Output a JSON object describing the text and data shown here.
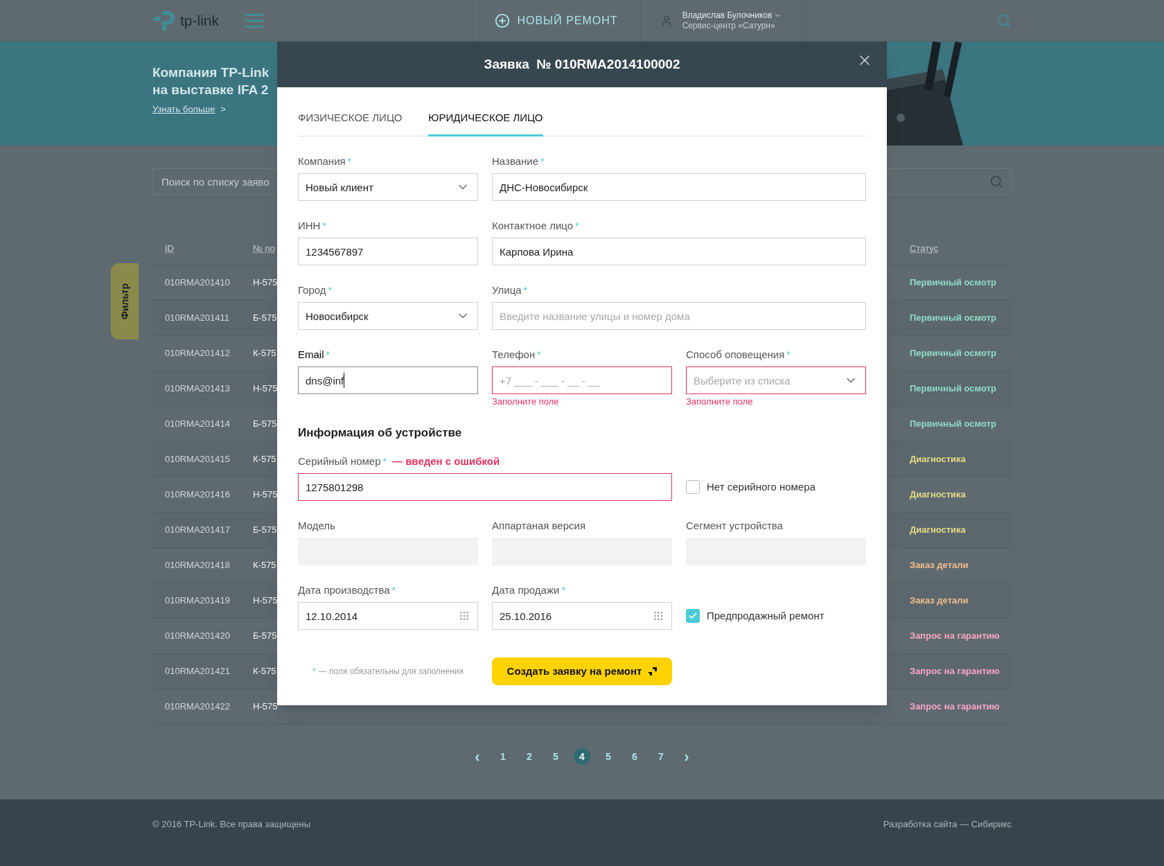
{
  "header": {
    "logo": "tp-link",
    "new_repair": "НОВЫЙ РЕМОНТ",
    "user_name": "Владислав Булочников",
    "user_org": "Сервис-центр «Сатурн»"
  },
  "banner": {
    "title_lines": [
      "Компания TP-Link",
      "на выставке IFA 2"
    ],
    "link": "Узнать больше",
    "link_arrow": ">"
  },
  "search": {
    "placeholder": "Поиск по списку заяво"
  },
  "filter_tab": {
    "label": "Фильтр"
  },
  "table": {
    "columns": [
      "ID",
      "№ по",
      "Статус"
    ],
    "rows": [
      {
        "id": "010RMA201410",
        "number": "Н-575",
        "status": "Первичный осмотр",
        "color": "#8fdcc4"
      },
      {
        "id": "010RMA201411",
        "number": "Б-575",
        "status": "Первичный осмотр",
        "color": "#8fdcc4"
      },
      {
        "id": "010RMA201412",
        "number": "К-575",
        "status": "Первичный осмотр",
        "color": "#8fdcc4"
      },
      {
        "id": "010RMA201413",
        "number": "Н-575",
        "status": "Первичный осмотр",
        "color": "#8fdcc4"
      },
      {
        "id": "010RMA201414",
        "number": "Б-575",
        "status": "Первичный осмотр",
        "color": "#8fdcc4"
      },
      {
        "id": "010RMA201415",
        "number": "К-575",
        "status": "Диагностика",
        "color": "#e6da86"
      },
      {
        "id": "010RMA201416",
        "number": "Н-575",
        "status": "Диагностика",
        "color": "#e6da86"
      },
      {
        "id": "010RMA201417",
        "number": "Б-575",
        "status": "Диагностика",
        "color": "#e6da86"
      },
      {
        "id": "010RMA201418",
        "number": "К-575",
        "status": "Заказ детали",
        "color": "#f2bb8c"
      },
      {
        "id": "010RMA201419",
        "number": "Н-575",
        "status": "Заказ детали",
        "color": "#f2bb8c"
      },
      {
        "id": "010RMA201420",
        "number": "Б-575",
        "status": "Запрос на гарантию",
        "color": "#f7a6c2"
      },
      {
        "id": "010RMA201421",
        "number": "К-575",
        "status": "Запрос на гарантию",
        "color": "#f7a6c2"
      },
      {
        "id": "010RMA201422",
        "number": "Н-575",
        "status": "Запрос на гарантию",
        "color": "#f7a6c2"
      }
    ]
  },
  "pagination": {
    "prev": "‹",
    "next": "›",
    "pages": [
      {
        "label": "1",
        "selected": false
      },
      {
        "label": "2",
        "selected": false
      },
      {
        "label": "5",
        "selected": false
      },
      {
        "label": "4",
        "selected": true
      },
      {
        "label": "5",
        "selected": false
      },
      {
        "label": "6",
        "selected": false
      },
      {
        "label": "7",
        "selected": false
      }
    ]
  },
  "footer": {
    "copyright": "© 2016 TP-Link. Все права защищены",
    "developer": "Разработка сайта — Сибирикс"
  },
  "modal": {
    "title": "Заявка  № 010RMA2014100002",
    "tabs": [
      {
        "label": "ФИЗИЧЕСКОЕ ЛИЦО",
        "selected": false
      },
      {
        "label": "ЮРИДИЧЕСКОЕ ЛИЦО",
        "selected": true
      }
    ],
    "client_rows": [
      {
        "fields": [
          {
            "kind": "select",
            "label": "Компания",
            "marker": "*",
            "value": "Новый клиент"
          },
          {
            "kind": "text",
            "label": "Название",
            "marker": "*",
            "value": "ДНС-Новосибирск"
          }
        ]
      },
      {
        "fields": [
          {
            "kind": "text",
            "label": "ИНН",
            "marker": "*",
            "value": "1234567897"
          },
          {
            "kind": "text",
            "label": "Контактное лицо",
            "marker": "*",
            "value": "Карпова Ирина"
          }
        ]
      },
      {
        "fields": [
          {
            "kind": "select",
            "label": "Город",
            "marker": "*",
            "value": "Новосибирск"
          },
          {
            "kind": "text",
            "label": "Улица",
            "marker": "*",
            "placeholder": "Введите название улицы и номер дома"
          }
        ]
      },
      {
        "fields": [
          {
            "kind": "text",
            "label": "Email",
            "marker": "*",
            "value": "dns@inf",
            "focused": true
          },
          {
            "kind": "text",
            "label": "Телефон",
            "marker": "*",
            "placeholder": "+7 ___ - ___ - __ - __",
            "error": "Заполните поле"
          },
          {
            "kind": "select",
            "label": "Способ оповещения",
            "marker": "*",
            "placeholder": "Выберите из списка",
            "error": "Заполните поле"
          }
        ]
      }
    ],
    "section_title": "Информация об устройстве",
    "device_rows": [
      {
        "fields": [
          {
            "kind": "text",
            "label": "Серийный номер",
            "marker": "*",
            "error_note": "— введен с ошибкой",
            "value": "1275801298",
            "invalid": true
          },
          {
            "kind": "checkbox",
            "label": "Нет серийного номера",
            "checked": false
          }
        ]
      },
      {
        "fields": [
          {
            "kind": "readonly",
            "label": "Модель"
          },
          {
            "kind": "readonly",
            "label": "Аппартаная версия"
          },
          {
            "kind": "readonly",
            "label": "Сегмент устройства"
          }
        ]
      },
      {
        "fields": [
          {
            "kind": "date",
            "label": "Дата производства",
            "marker": "*",
            "value": "12.10.2014"
          },
          {
            "kind": "date",
            "label": "Дата продажи",
            "marker": "*",
            "value": "25.10.2016"
          },
          {
            "kind": "checkbox",
            "label": "Предпродажный ремонт",
            "checked": true
          }
        ]
      }
    ],
    "required_note": {
      "marker": "*",
      "text": "— поля обязательны для заполнения"
    },
    "submit": "Создать заявку на ремонт"
  }
}
